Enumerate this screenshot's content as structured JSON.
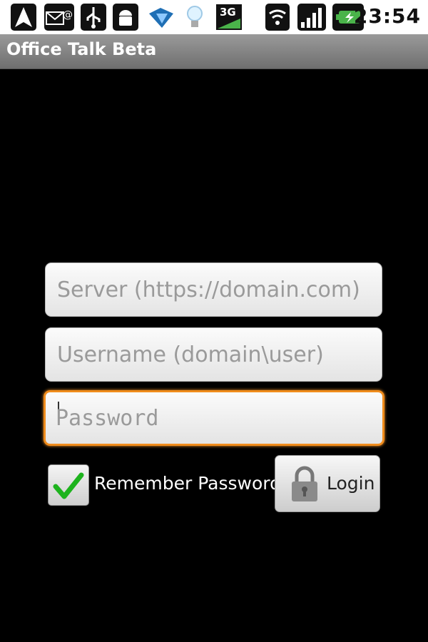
{
  "status_bar": {
    "time": "23:54",
    "network_label": "3G",
    "icons": [
      "navigation-icon",
      "mail-icon",
      "usb-icon",
      "android-debug-icon",
      "download-icon",
      "lightbulb-icon",
      "3g-icon",
      "wifi-icon",
      "signal-icon",
      "battery-charging-icon"
    ]
  },
  "app": {
    "title": "Office Talk Beta"
  },
  "form": {
    "server": {
      "placeholder": "Server (https://domain.com)",
      "value": ""
    },
    "username": {
      "placeholder": "Username (domain\\user)",
      "value": ""
    },
    "password": {
      "placeholder": "Password",
      "value": ""
    },
    "remember": {
      "label": "Remember Password",
      "checked": true
    },
    "login": {
      "label": "Login",
      "icon": "lock-icon"
    }
  },
  "colors": {
    "focus": "#f08c1c",
    "check": "#1db31d"
  }
}
